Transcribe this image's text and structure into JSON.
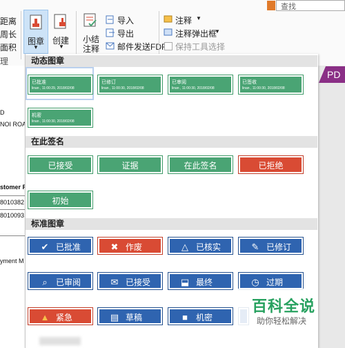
{
  "search": {
    "placeholder": "查找"
  },
  "ribbon": {
    "left_items": [
      "距离",
      "周长",
      "面积",
      "理"
    ],
    "stamp_label": "图章",
    "create_label": "创建",
    "summarize_label": "小结\n注释",
    "import_label": "导入",
    "export_label": "导出",
    "email_label": "邮件发送FDF",
    "comment_label": "注释",
    "comment_popup_label": "注释弹出框",
    "keep_tool_label": "保持工具选择"
  },
  "doc": {
    "lines": [
      "D",
      "NOI ROA",
      "stomer P",
      "8010382",
      "8010093",
      "yment M"
    ]
  },
  "right": {
    "tab_label": "PD"
  },
  "dropdown": {
    "dynamic": {
      "title": "动态图章",
      "stamps": [
        {
          "label": "已批准",
          "sub": "linan , 11:00:29, 2018/02/08"
        },
        {
          "label": "已修订",
          "sub": "linan , 11:00:30, 2018/02/08"
        },
        {
          "label": "已审阅",
          "sub": "linan , 11:00:30, 2018/02/08"
        },
        {
          "label": "已签收",
          "sub": "linan , 11:00:30, 2018/02/08"
        },
        {
          "label": "机密",
          "sub": "linan , 11:00:30, 2018/02/08"
        }
      ]
    },
    "sign_here": {
      "title": "在此签名",
      "stamps": [
        "已接受",
        "证据",
        "在此签名",
        "已拒绝",
        "初始"
      ]
    },
    "standard": {
      "title": "标准图章",
      "stamps": [
        "已批准",
        "作废",
        "已核实",
        "已修订",
        "已审阅",
        "已接受",
        "最终",
        "过期",
        "紧急",
        "草稿",
        "机密"
      ]
    }
  },
  "watermark": {
    "title": "百科全说",
    "subtitle": "助你轻松解决"
  },
  "colors": {
    "green": "#4aa474",
    "red": "#d94b34",
    "blue": "#2f64b0",
    "accent": "#8a2f86"
  }
}
